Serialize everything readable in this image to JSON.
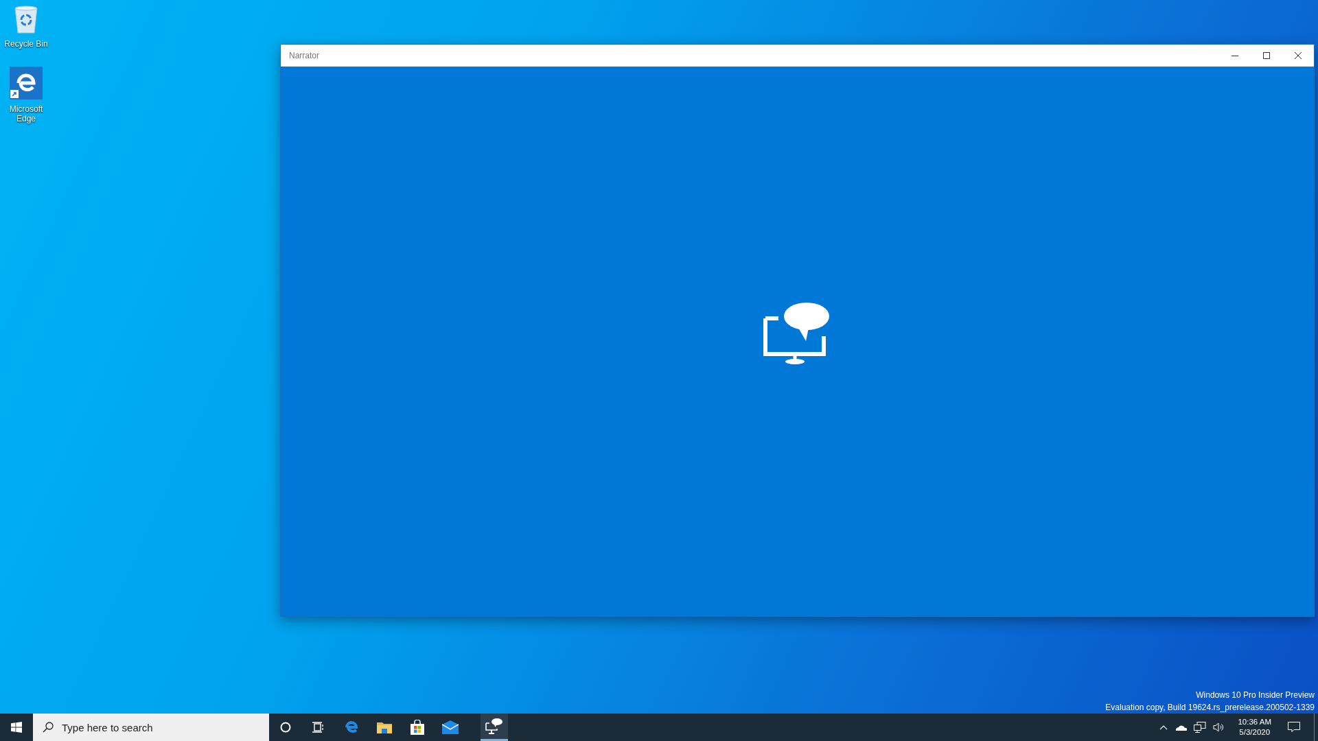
{
  "desktop_icons": [
    {
      "kind": "recycle",
      "label": "Recycle Bin"
    },
    {
      "kind": "edge",
      "label": "Microsoft Edge"
    }
  ],
  "window": {
    "title": "Narrator"
  },
  "build_info": [
    "Windows 10 Pro Insider Preview",
    "Evaluation copy, Build 19624.rs_prerelease.200502-1339"
  ],
  "taskbar": {
    "search": {
      "placeholder": "Type here to search"
    },
    "apps": [
      {
        "kind": "cortana",
        "selected": false
      },
      {
        "kind": "taskview",
        "selected": false
      },
      {
        "kind": "edge",
        "selected": false
      },
      {
        "kind": "explorer",
        "selected": false
      },
      {
        "kind": "store",
        "selected": false
      },
      {
        "kind": "mail",
        "selected": false
      },
      {
        "kind": "narrator",
        "selected": true
      }
    ],
    "clock": {
      "time": "10:36 AM",
      "date": "5/3/2020"
    }
  }
}
